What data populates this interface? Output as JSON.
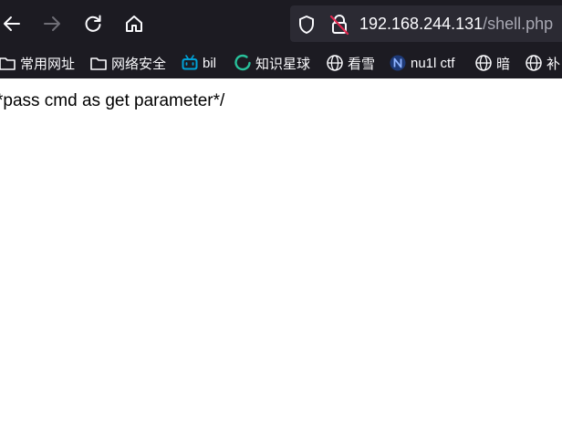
{
  "toolbar": {
    "back_icon": "arrow-left-icon",
    "forward_icon": "arrow-right-icon",
    "reload_icon": "reload-icon",
    "home_icon": "home-icon"
  },
  "urlbar": {
    "host": "192.168.244.131",
    "path": "/shell.php",
    "shield_icon": "shield-icon",
    "lock_icon": "insecure-lock-icon"
  },
  "bookmarks": [
    {
      "label": "常用网址",
      "icon": "folder-icon"
    },
    {
      "label": "网络安全",
      "icon": "folder-icon"
    },
    {
      "label": "bil",
      "icon": "bilibili-icon"
    },
    {
      "label": "知识星球",
      "icon": "planet-icon"
    },
    {
      "label": "看雪",
      "icon": "globe-icon"
    },
    {
      "label": "nu1l ctf",
      "icon": "n-logo-icon"
    },
    {
      "label": "暗",
      "icon": "globe-icon"
    },
    {
      "label": "补",
      "icon": "globe-icon"
    }
  ],
  "page": {
    "text": "*pass cmd as get parameter*/"
  },
  "colors": {
    "chrome_bg": "#1c1b22",
    "urlbar_bg": "#2b2a33",
    "bilibili": "#00a1d6",
    "planet": "#28c19b",
    "nu1l": "#1e3a78"
  }
}
